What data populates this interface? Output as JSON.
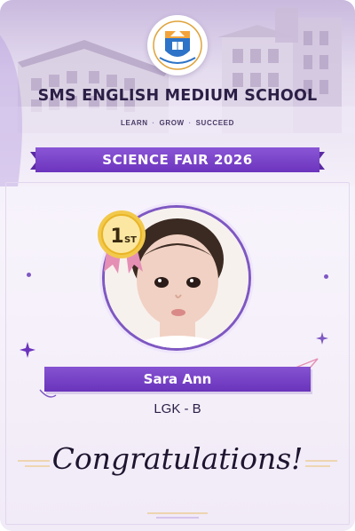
{
  "school": {
    "name": "SMS ENGLISH MEDIUM SCHOOL",
    "tagline_words": [
      "LEARN",
      "GROW",
      "SUCCEED"
    ]
  },
  "event": {
    "title": "SCIENCE FAIR 2026"
  },
  "award": {
    "rank": "1",
    "rank_suffix": "ST"
  },
  "student": {
    "name": "Sara Ann",
    "class": "LGK - B"
  },
  "message": "Congratulations!",
  "colors": {
    "primary_purple": "#6c34bd",
    "accent_gold": "#e9b526",
    "ribbon_pink": "#e58fb5",
    "text_dark": "#2b1f46"
  },
  "icons": [
    "school-logo-icon",
    "medal-icon",
    "star-icon",
    "paper-plane-icon"
  ]
}
